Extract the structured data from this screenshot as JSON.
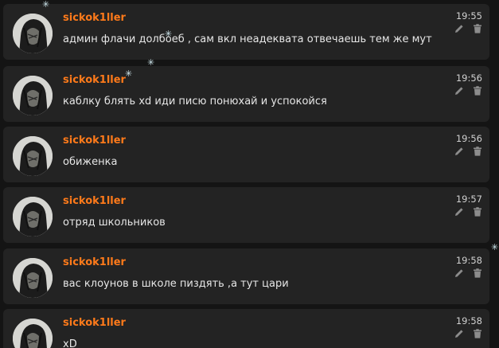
{
  "messages": [
    {
      "author": "sickok1ller",
      "time": "19:55",
      "text": "админ флачи долбоеб , сам вкл неадеквата отвечаешь тем же мут"
    },
    {
      "author": "sickok1ller",
      "time": "19:56",
      "text": "каблку блять xd иди писю понюхай и успокойся"
    },
    {
      "author": "sickok1ller",
      "time": "19:56",
      "text": "обиженка"
    },
    {
      "author": "sickok1ller",
      "time": "19:57",
      "text": "отряд школьников"
    },
    {
      "author": "sickok1ller",
      "time": "19:58",
      "text": "вас клоунов в школе пиздять ,а тут цари"
    },
    {
      "author": "sickok1ller",
      "time": "19:58",
      "text": "xD"
    }
  ],
  "icons": {
    "edit": "pencil-icon",
    "delete": "trash-icon",
    "decoration": "snowflake-icon"
  },
  "colors": {
    "background": "#141414",
    "card": "#232323",
    "author": "#ff7a1a",
    "text": "#e6e6e6",
    "time": "#d0d0d0",
    "icon": "#8c8c8c"
  }
}
